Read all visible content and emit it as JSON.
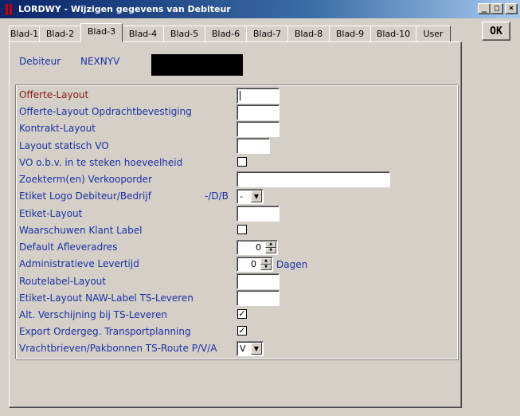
{
  "window": {
    "title": "LORDWY - Wijzigen gegevens van Debiteur",
    "minimize_label": "_",
    "maximize_label": "□",
    "close_label": "×",
    "ok_label": "OK"
  },
  "tabs": [
    {
      "label": "Blad-1"
    },
    {
      "label": "Blad-2"
    },
    {
      "label": "Blad-3",
      "active": true
    },
    {
      "label": "Blad-4"
    },
    {
      "label": "Blad-5"
    },
    {
      "label": "Blad-6"
    },
    {
      "label": "Blad-7"
    },
    {
      "label": "Blad-8"
    },
    {
      "label": "Blad-9"
    },
    {
      "label": "Blad-10"
    },
    {
      "label": "User"
    }
  ],
  "debiteur": {
    "label": "Debiteur",
    "code": "NEXNYV",
    "name": ""
  },
  "fields": {
    "offerte_layout": {
      "label": "Offerte-Layout",
      "value": ""
    },
    "offerte_layout_opdracht": {
      "label": "Offerte-Layout Opdrachtbevestiging",
      "value": ""
    },
    "kontrakt_layout": {
      "label": "Kontrakt-Layout",
      "value": ""
    },
    "layout_statisch_vo": {
      "label": "Layout statisch VO",
      "value": ""
    },
    "vo_obv_steken": {
      "label": "VO o.b.v. in te steken hoeveelheid",
      "checked": ""
    },
    "zoekterm_verkooporder": {
      "label": "Zoekterm(en) Verkooporder",
      "value": ""
    },
    "etiket_logo": {
      "label": "Etiket Logo Debiteur/Bedrijf",
      "hint": "-/D/B",
      "value": "-"
    },
    "etiket_layout": {
      "label": "Etiket-Layout",
      "value": ""
    },
    "waarschuwen_klant_label": {
      "label": "Waarschuwen Klant Label",
      "checked": ""
    },
    "default_afleveradres": {
      "label": "Default Afleveradres",
      "value": "0"
    },
    "administratieve_levertijd": {
      "label": "Administratieve Levertijd",
      "value": "0",
      "unit": "Dagen"
    },
    "routelabel_layout": {
      "label": "Routelabel-Layout",
      "value": ""
    },
    "etiket_layout_naw": {
      "label": "Etiket-Layout NAW-Label TS-Leveren",
      "value": ""
    },
    "alt_verschijning": {
      "label": "Alt. Verschijning bij TS-Leveren",
      "checked": "✓"
    },
    "export_ordergeg": {
      "label": "Export Ordergeg. Transportplanning",
      "checked": "✓"
    },
    "vrachtbrieven": {
      "label": "Vrachtbrieven/Pakbonnen TS-Route P/V/A",
      "value": "V"
    }
  },
  "icons": {
    "dropdown_arrow": "▼",
    "spin_up": "▲",
    "spin_down": "▼"
  }
}
